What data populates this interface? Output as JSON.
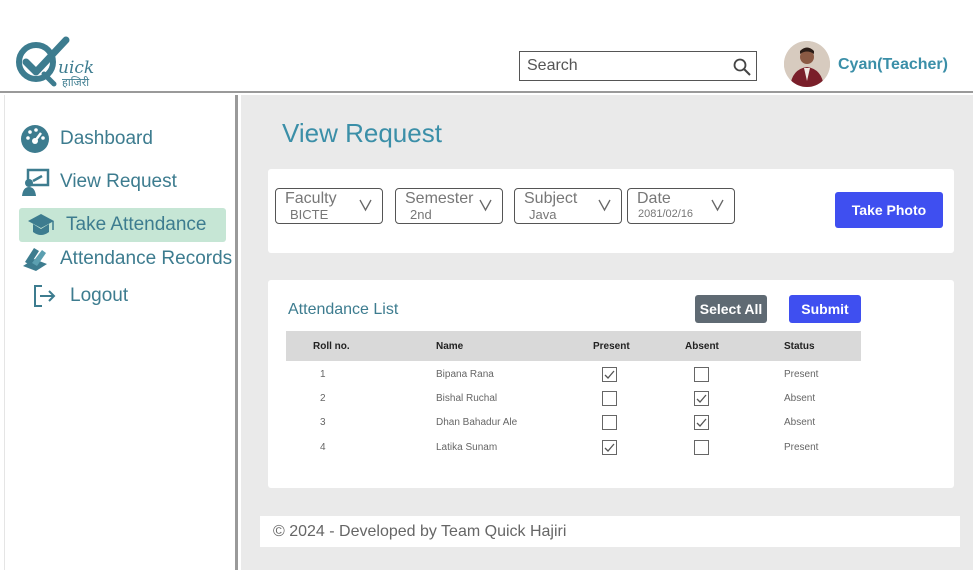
{
  "header": {
    "logo": {
      "text": "uick",
      "sub": "हाजिरी"
    },
    "search": {
      "placeholder": "Search",
      "value": ""
    },
    "user": {
      "name": "Cyan(Teacher)"
    }
  },
  "sidebar": {
    "items": [
      {
        "label": "Dashboard",
        "icon": "dashboard-icon"
      },
      {
        "label": "View Request",
        "icon": "view-request-icon"
      },
      {
        "label": "Take Attendance",
        "icon": "graduation-cap-icon",
        "active": true
      },
      {
        "label": "Attendance Records",
        "icon": "books-icon"
      },
      {
        "label": "Logout",
        "icon": "logout-icon"
      }
    ]
  },
  "main": {
    "title": "View Request",
    "filters": {
      "faculty": {
        "label": "Faculty",
        "value": "BICTE"
      },
      "semester": {
        "label": "Semester",
        "value": "2nd"
      },
      "subject": {
        "label": "Subject",
        "value": "Java"
      },
      "date": {
        "label": "Date",
        "value": "2081/02/16"
      }
    },
    "take_photo_label": "Take Photo",
    "attendance": {
      "title": "Attendance List",
      "select_all_label": "Select All",
      "submit_label": "Submit",
      "columns": [
        "Roll no.",
        "Name",
        "Present",
        "Absent",
        "Status"
      ],
      "rows": [
        {
          "roll": "1",
          "name": "Bipana Rana",
          "present": true,
          "absent": false,
          "status": "Present"
        },
        {
          "roll": "2",
          "name": "Bishal Ruchal",
          "present": false,
          "absent": true,
          "status": "Absent"
        },
        {
          "roll": "3",
          "name": "Dhan Bahadur Ale",
          "present": false,
          "absent": true,
          "status": "Absent"
        },
        {
          "roll": "4",
          "name": "Latika Sunam",
          "present": true,
          "absent": false,
          "status": "Present"
        }
      ]
    }
  },
  "footer": {
    "text": "© 2024 - Developed by Team Quick Hajiri"
  },
  "colors": {
    "accent": "#3b8fa8",
    "primary_button": "#3f4ff0",
    "active_nav": "#c6e6d5",
    "secondary_button": "#5f6a73"
  }
}
